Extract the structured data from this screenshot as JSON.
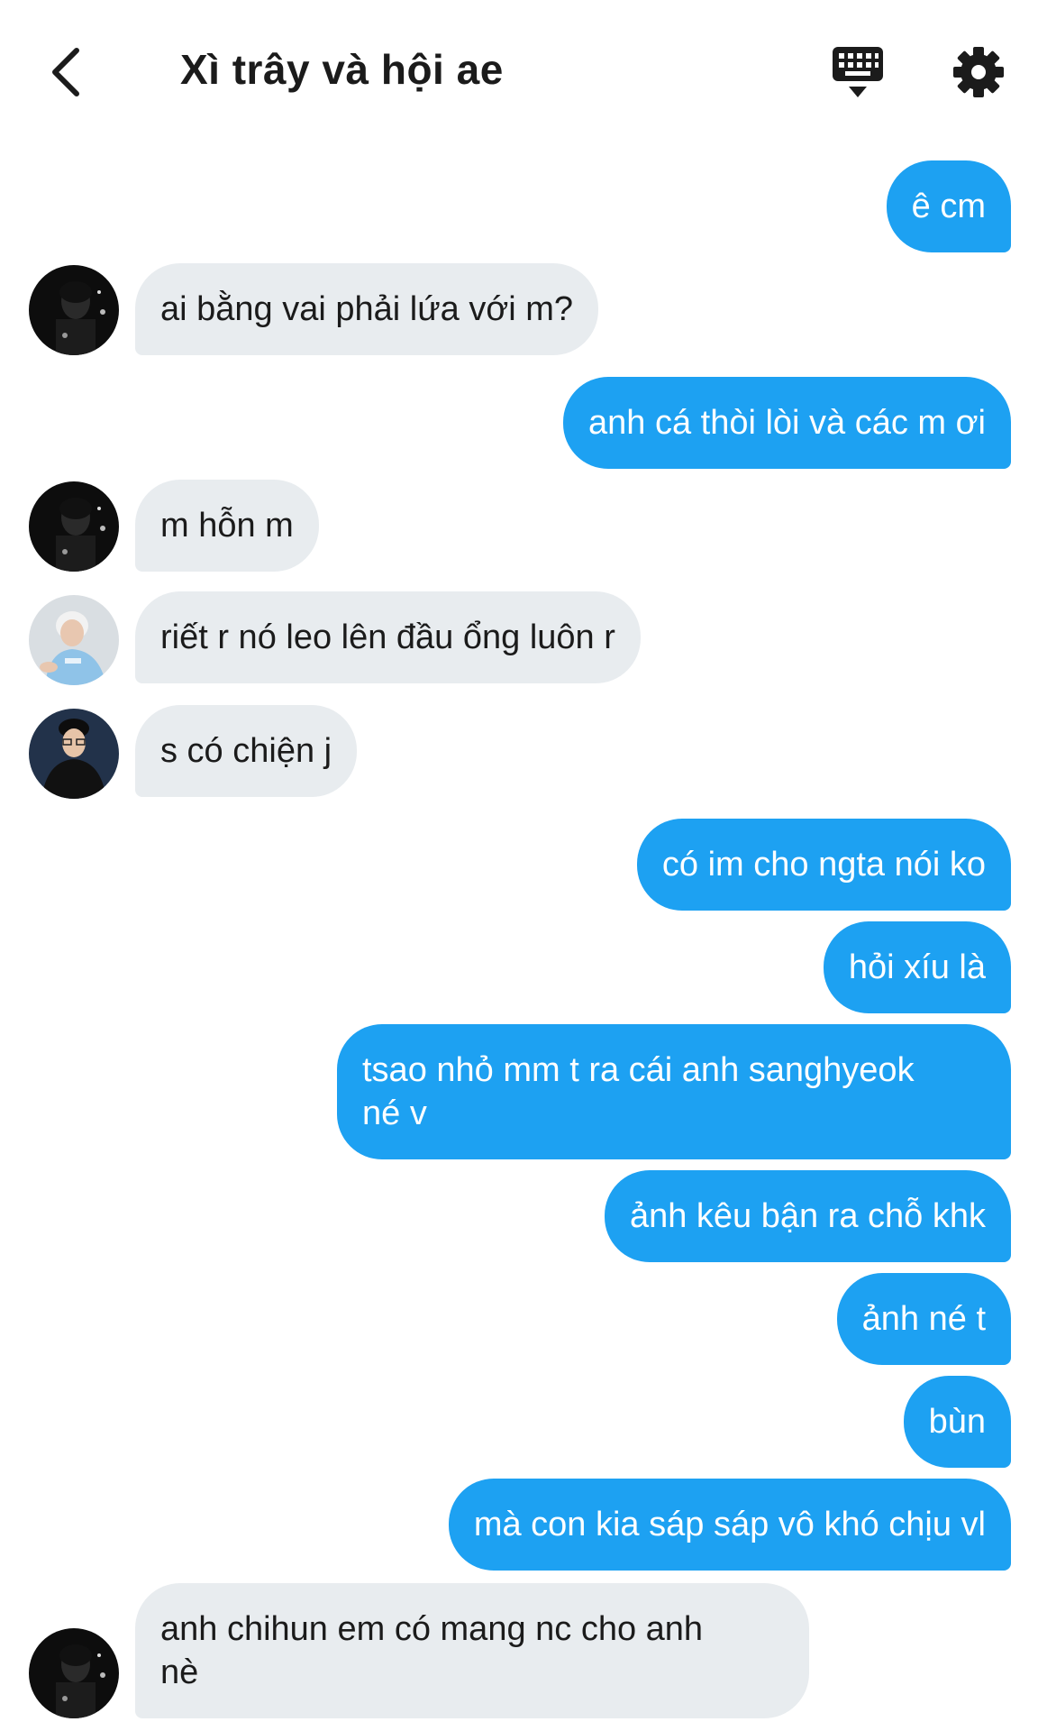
{
  "header": {
    "title": "Xì trây và hội ae",
    "back_icon": "chevron-left-icon",
    "keyboard_icon": "keyboard-icon",
    "settings_icon": "gear-icon"
  },
  "colors": {
    "outgoing_bubble": "#1da1f2",
    "incoming_bubble": "#e8ecef",
    "text_dark": "#1b1b1b"
  },
  "messages": [
    {
      "id": "m1",
      "direction": "out",
      "text": "ê cm"
    },
    {
      "id": "m2",
      "direction": "in",
      "avatar": "avatar-1",
      "text": "ai bằng vai phải lứa với m?"
    },
    {
      "id": "m3",
      "direction": "out",
      "text": "anh cá thòi lòi và các m ơi"
    },
    {
      "id": "m4",
      "direction": "in",
      "avatar": "avatar-1",
      "text": "m hỗn m"
    },
    {
      "id": "m5",
      "direction": "in",
      "avatar": "avatar-2",
      "text": "riết r nó leo lên đầu ổng luôn r"
    },
    {
      "id": "m6",
      "direction": "in",
      "avatar": "avatar-3",
      "text": "s có chiện j"
    },
    {
      "id": "m7",
      "direction": "out",
      "text": "có im cho ngta nói ko"
    },
    {
      "id": "m8",
      "direction": "out",
      "text": "hỏi xíu là"
    },
    {
      "id": "m9",
      "direction": "out",
      "text": "tsao nhỏ mm t ra cái anh sanghyeok\nné v"
    },
    {
      "id": "m10",
      "direction": "out",
      "text": "ảnh kêu bận ra chỗ khk"
    },
    {
      "id": "m11",
      "direction": "out",
      "text": "ảnh né t"
    },
    {
      "id": "m12",
      "direction": "out",
      "text": "bùn"
    },
    {
      "id": "m13",
      "direction": "out",
      "text": "mà con kia sáp sáp vô khó chịu vl"
    },
    {
      "id": "m14",
      "direction": "in",
      "avatar": "avatar-1",
      "text": "anh chihun em có mang nc cho anh\nnè"
    }
  ]
}
